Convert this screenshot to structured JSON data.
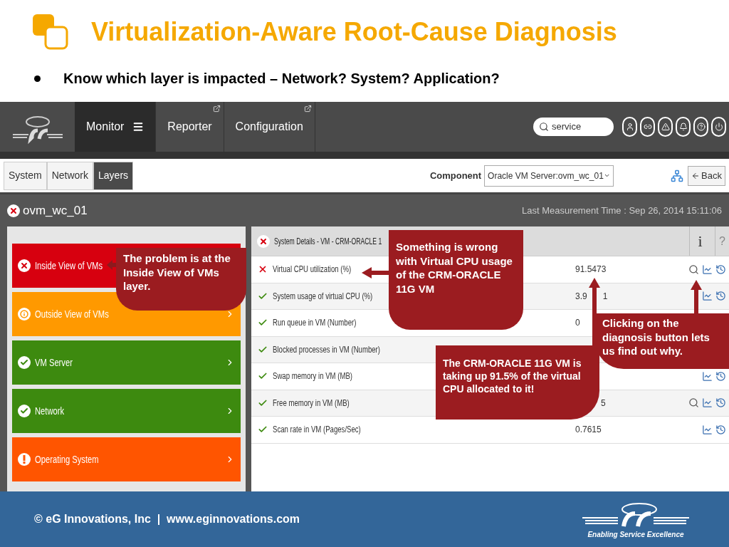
{
  "slide": {
    "title": "Virtualization-Aware Root-Cause Diagnosis",
    "bullet": "Know which layer is impacted – Network? System? Application?"
  },
  "nav": {
    "tabs": [
      {
        "label": "Monitor",
        "selected": true,
        "menu": true,
        "external": false
      },
      {
        "label": "Reporter",
        "selected": false,
        "menu": false,
        "external": true
      },
      {
        "label": "Configuration",
        "selected": false,
        "menu": false,
        "external": true
      }
    ],
    "search": {
      "value": "service"
    }
  },
  "view_tabs": [
    {
      "label": "System",
      "selected": false
    },
    {
      "label": "Network",
      "selected": false
    },
    {
      "label": "Layers",
      "selected": true
    }
  ],
  "component": {
    "label": "Component",
    "value": "Oracle VM Server:ovm_wc_01",
    "back": "Back"
  },
  "server": {
    "name": "ovm_wc_01",
    "kind": "error",
    "last_measurement": "Last Measurement Time : Sep 26, 2014 15:11:06"
  },
  "layers": [
    {
      "label": "Inside View of VMs",
      "kind": "error",
      "color": "#d7000f"
    },
    {
      "label": "Outside View of VMs",
      "kind": "info",
      "color": "#ff9900",
      "chevron": true
    },
    {
      "label": "VM Server",
      "kind": "ok",
      "color": "#3d8a0f",
      "chevron": true
    },
    {
      "label": "Network",
      "kind": "ok",
      "color": "#3d8a0f",
      "chevron": true
    },
    {
      "label": "Operating System",
      "kind": "warning",
      "color": "#ff5500",
      "chevron": true
    }
  ],
  "details": {
    "title": "System Details - VM - CRM-ORACLE 1",
    "info": "i",
    "help": "?",
    "rows": [
      {
        "kind": "error",
        "label": "Virtual CPU utilization (%)",
        "value": "91.5473",
        "diagnosis": true,
        "graphs": true
      },
      {
        "kind": "ok",
        "label": "System usage of virtual CPU (%)",
        "value": "3.9",
        "value_after": "1",
        "diagnosis": false,
        "graphs": true
      },
      {
        "kind": "ok",
        "label": "Run queue in VM (Number)",
        "value": "0"
      },
      {
        "kind": "ok",
        "label": "Blocked processes in VM (Number)"
      },
      {
        "kind": "ok",
        "label": "Swap memory in VM (MB)",
        "diagnosis": false,
        "graphs": true
      },
      {
        "kind": "ok",
        "label": "Free memory in VM (MB)",
        "value_after": "5",
        "diagnosis": true,
        "graphs": true
      },
      {
        "kind": "ok",
        "label": "Scan rate in VM (Pages/Sec)",
        "value": "0.7615",
        "diagnosis": false,
        "graphs": true
      }
    ]
  },
  "callouts": [
    {
      "text": "The problem is at the Inside View of VMs layer."
    },
    {
      "text": "Something is wrong with Virtual CPU usage of the CRM-ORACLE 11G VM"
    },
    {
      "text": "Clicking on the diagnosis button lets us find out why."
    },
    {
      "text": "The CRM-ORACLE 11G VM is taking up 91.5% of the virtual CPU allocated to it!"
    }
  ],
  "footer": {
    "copyright": "© eG Innovations, Inc  |  www.eginnovations.com",
    "tagline": "Enabling Service Excellence"
  }
}
